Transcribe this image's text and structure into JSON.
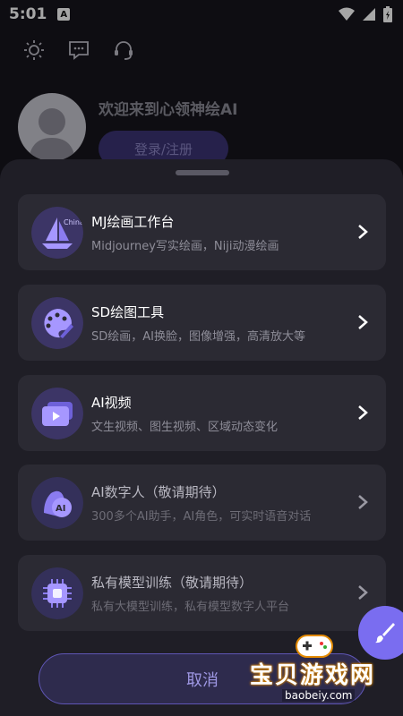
{
  "status_bar": {
    "time": "5:01",
    "notification_icon": "a-app-icon",
    "wifi_icon": "wifi-icon",
    "signal_icon": "signal-icon",
    "battery_icon": "battery-icon"
  },
  "top_icons": [
    "theme-sun-icon",
    "message-icon",
    "support-headset-icon"
  ],
  "profile": {
    "welcome": "欢迎来到心领神绘AI",
    "login_label": "登录/注册"
  },
  "menu": [
    {
      "title": "MJ绘画工作台",
      "subtitle": "Midjourney写实绘画，Niji动漫绘画",
      "icon": "sailboat-icon",
      "enabled": true
    },
    {
      "title": "SD绘图工具",
      "subtitle": "SD绘画，AI换脸，图像增强，高清放大等",
      "icon": "palette-icon",
      "enabled": true
    },
    {
      "title": "AI视频",
      "subtitle": "文生视频、图生视频、区域动态变化",
      "icon": "video-icon",
      "enabled": true
    },
    {
      "title": "AI数字人（敬请期待）",
      "subtitle": "300多个AI助手，AI角色，可实时语音对话",
      "icon": "ai-avatar-icon",
      "enabled": false
    },
    {
      "title": "私有模型训练（敬请期待）",
      "subtitle": "私有大模型训练，私有模型数字人平台",
      "icon": "chip-icon",
      "enabled": false
    }
  ],
  "cancel_label": "取消",
  "fab_icon": "brush-icon",
  "watermark": {
    "text": "宝贝游戏网",
    "url": "baobeiy.com"
  },
  "colors": {
    "accent": "#7a6df0",
    "sheet": "#1f1e26",
    "card": "#2b2a33"
  }
}
